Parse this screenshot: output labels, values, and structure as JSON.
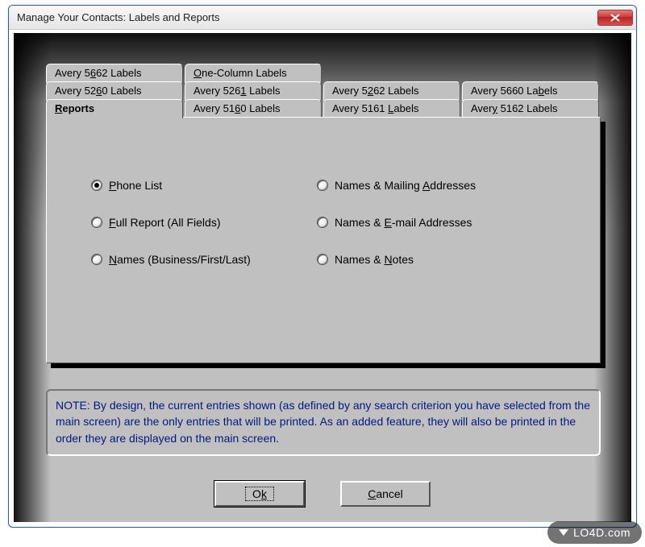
{
  "window": {
    "title": "Manage Your Contacts: Labels and Reports"
  },
  "tabs": {
    "row3": [
      {
        "pre": "Avery 5",
        "u": "6",
        "post": "62 Labels"
      },
      {
        "pre": "",
        "u": "O",
        "post": "ne-Column Labels"
      }
    ],
    "row2": [
      {
        "pre": "Avery 52",
        "u": "6",
        "post": "0 Labels"
      },
      {
        "pre": "Avery 526",
        "u": "1",
        "post": " Labels"
      },
      {
        "pre": "Avery 5",
        "u": "2",
        "post": "62 Labels"
      },
      {
        "pre": "Avery 5660 La",
        "u": "b",
        "post": "els"
      }
    ],
    "row1": [
      {
        "pre": "",
        "u": "R",
        "post": "eports",
        "active": true
      },
      {
        "pre": "Avery 51",
        "u": "6",
        "post": "0 Labels"
      },
      {
        "pre": "Avery 5161 ",
        "u": "L",
        "post": "abels"
      },
      {
        "pre": "Aver",
        "u": "y",
        "post": " 5162 Labels"
      }
    ]
  },
  "radios": [
    {
      "pre": "",
      "u": "P",
      "post": "hone List",
      "selected": true
    },
    {
      "pre": "Names & Mailing ",
      "u": "A",
      "post": "ddresses",
      "selected": false
    },
    {
      "pre": "",
      "u": "F",
      "post": "ull Report (All Fields)",
      "selected": false
    },
    {
      "pre": "Names & ",
      "u": "E",
      "post": "-mail Addresses",
      "selected": false
    },
    {
      "pre": "",
      "u": "N",
      "post": "ames (Business/First/Last)",
      "selected": false
    },
    {
      "pre": "Names & ",
      "u": "N",
      "post": "otes",
      "selected": false
    }
  ],
  "note": "NOTE: By design, the current entries shown (as defined by any search criterion you have selected from the main screen) are the only entries that will be printed.  As an added feature, they will also be printed in the order they are displayed on the main screen.",
  "buttons": {
    "ok": {
      "pre": "O",
      "u": "k",
      "post": ""
    },
    "cancel": {
      "pre": "",
      "u": "C",
      "post": "ancel"
    }
  },
  "watermark": "LO4D.com"
}
